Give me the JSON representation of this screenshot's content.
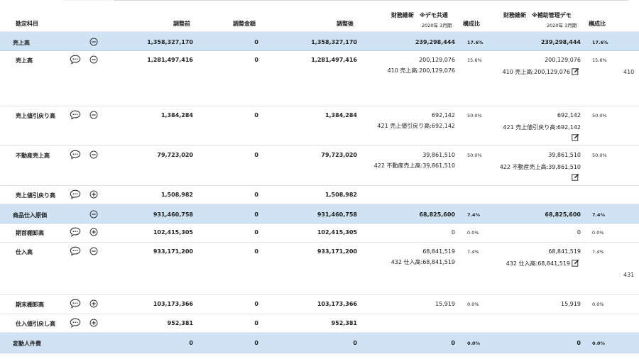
{
  "header": {
    "col_account": "勘定科目",
    "col_before": "調整前",
    "col_adjust": "調整金額",
    "col_after": "調整後",
    "col_fin1": "財務維新　※デモ共通",
    "col_fin1_sub": "2020年 3月期",
    "col_ratio1": "構成比",
    "col_fin2": "財務維新　※補助管理デモ",
    "col_fin2_sub": "2020年 3月期",
    "col_ratio2": "構成比"
  },
  "rows": [
    {
      "name": "売上高",
      "before": "1,358,327,170",
      "adjust": "0",
      "after": "1,358,327,170",
      "f1": "239,298,444",
      "r1": "17.6%",
      "f2": "239,298,444",
      "r2": "17.6%"
    },
    {
      "name": "売上高",
      "before": "1,281,497,416",
      "adjust": "0",
      "after": "1,281,497,416",
      "f1": "200,129,076",
      "f1_sub": "410 売上高:200,129,076",
      "r1": "15.6%",
      "f2": "200,129,076",
      "f2_sub": "410 売上高:200,129,076",
      "r2": "15.6%",
      "cut": "410"
    },
    {
      "name": "売上値引戻り高",
      "before": "1,384,284",
      "adjust": "0",
      "after": "1,384,284",
      "f1": "692,142",
      "f1_sub": "421 売上値引戻り高:692,142",
      "r1": "50.0%",
      "f2": "692,142",
      "f2_sub": "421 売上値引戻り高:692,142",
      "r2": "50.0%"
    },
    {
      "name": "不動産売上高",
      "before": "79,723,020",
      "adjust": "0",
      "after": "79,723,020",
      "f1": "39,861,510",
      "f1_sub": "422 不動産売上高:39,861,510",
      "r1": "50.0%",
      "f2": "39,861,510",
      "f2_sub": "422 不動産売上高:39,861,510",
      "r2": "50.0%"
    },
    {
      "name": "売上値引戻り高",
      "before": "1,508,982",
      "adjust": "0",
      "after": "1,508,982"
    },
    {
      "name": "商品仕入原価",
      "before": "931,460,758",
      "adjust": "0",
      "after": "931,460,758",
      "f1": "68,825,600",
      "r1": "7.4%",
      "f2": "68,825,600",
      "r2": "7.4%"
    },
    {
      "name": "期首棚卸高",
      "before": "102,415,305",
      "adjust": "0",
      "after": "102,415,305",
      "f1": "0",
      "r1": "0.0%",
      "f2": "0",
      "r2": "0.0%"
    },
    {
      "name": "仕入高",
      "before": "933,171,200",
      "adjust": "0",
      "after": "933,171,200",
      "f1": "68,841,519",
      "f1_sub": "432 仕入高:68,841,519",
      "r1": "7.4%",
      "f2": "68,841,519",
      "f2_sub": "432 仕入高:68,841,519",
      "r2": "7.4%",
      "cut": "431"
    },
    {
      "name": "期末棚卸高",
      "before": "103,173,366",
      "adjust": "0",
      "after": "103,173,366",
      "f1": "15,919",
      "r1": "0.0%",
      "f2": "15,919",
      "r2": "0.0%"
    },
    {
      "name": "仕入値引戻し高",
      "before": "952,381",
      "adjust": "0",
      "after": "952,381"
    },
    {
      "name": "変動人件費",
      "before": "0",
      "adjust": "0",
      "after": "0",
      "f1": "0",
      "r1": "0.0%",
      "f2": "0",
      "r2": "0.0%"
    }
  ]
}
